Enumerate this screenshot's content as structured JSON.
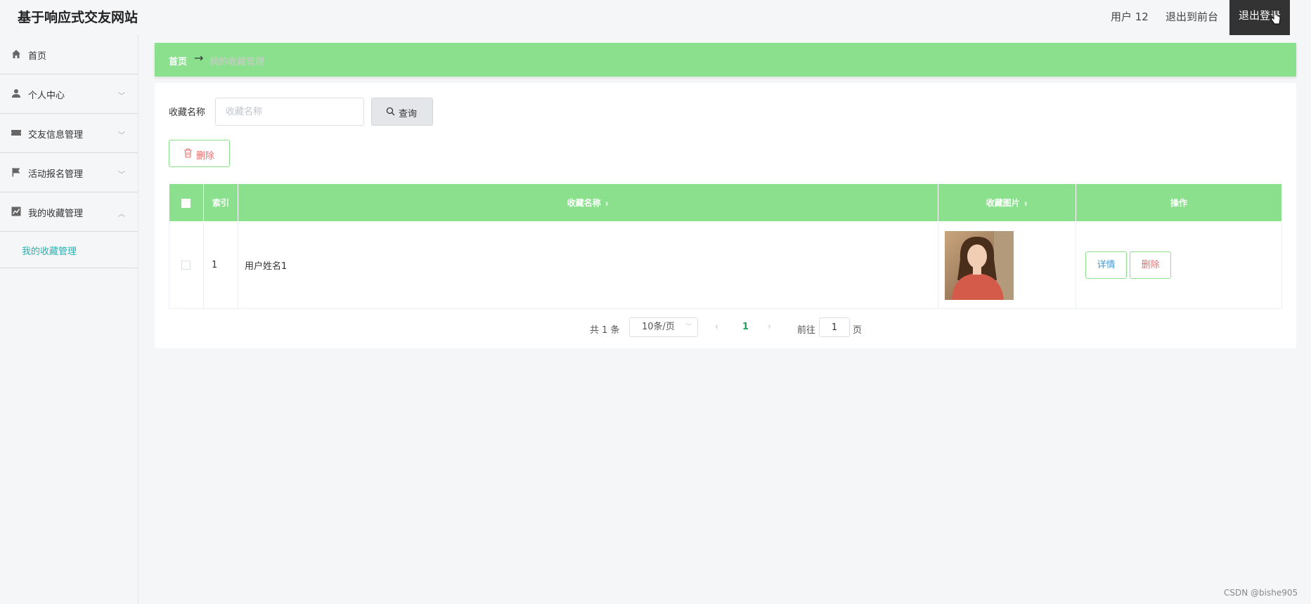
{
  "header": {
    "brand": "基于响应式交友网站",
    "user_label": "用户 12",
    "front_label": "退出到前台",
    "logout_label": "退出登录"
  },
  "sidebar": {
    "items": [
      {
        "label": "首页",
        "icon": "home-icon"
      },
      {
        "label": "个人中心",
        "icon": "user-icon"
      },
      {
        "label": "交友信息管理",
        "icon": "ticket-icon"
      },
      {
        "label": "活动报名管理",
        "icon": "flag-icon"
      },
      {
        "label": "我的收藏管理",
        "icon": "chart-icon"
      }
    ],
    "sub_items": [
      {
        "label": "我的收藏管理"
      }
    ]
  },
  "breadcrumb": {
    "home": "首页",
    "separator": "→",
    "current": "我的收藏管理"
  },
  "search": {
    "label": "收藏名称",
    "placeholder": "收藏名称",
    "button_label": "查询"
  },
  "toolbar": {
    "delete_label": "删除"
  },
  "table": {
    "columns": [
      "索引",
      "收藏名称",
      "收藏图片",
      "操作"
    ],
    "rows": [
      {
        "index": "1",
        "name": "用户姓名1",
        "detail_label": "详情",
        "delete_label": "删除"
      }
    ]
  },
  "pagination": {
    "total": "共 1 条",
    "page_size": "10条/页",
    "current_page": "1",
    "goto_label": "前往",
    "goto_value": "1",
    "page_unit": "页"
  },
  "watermark": "CSDN @bishe905",
  "colors": {
    "accent": "#8ae08c",
    "link": "#2bb0b0",
    "danger": "#e57070",
    "dark": "#333333"
  }
}
